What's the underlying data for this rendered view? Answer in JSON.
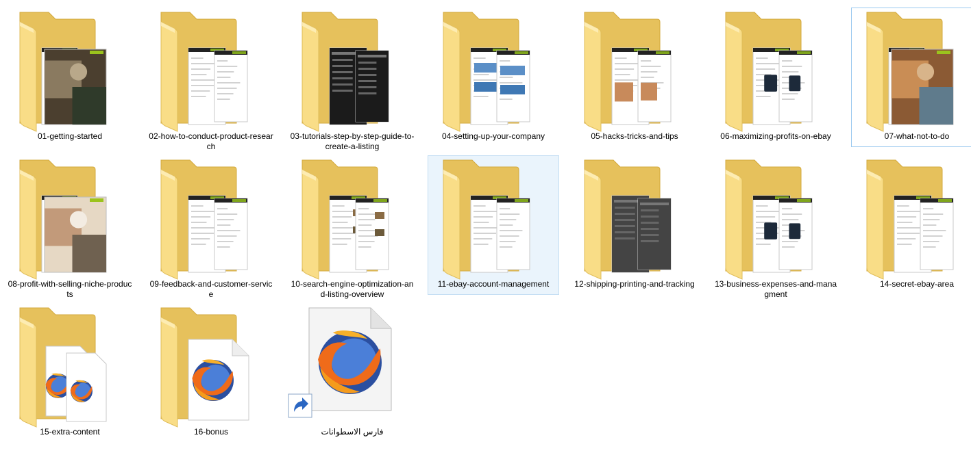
{
  "items": [
    {
      "label": "01-getting-started",
      "kind": "folder",
      "preview": "photo",
      "focus": false,
      "hover": false
    },
    {
      "label": "02-how-to-conduct-product-research",
      "kind": "folder",
      "preview": "screens",
      "focus": false,
      "hover": false
    },
    {
      "label": "03-tutorials-step-by-step-guide-to-create-a-listing",
      "kind": "folder",
      "preview": "dark",
      "focus": false,
      "hover": false
    },
    {
      "label": "04-setting-up-your-company",
      "kind": "folder",
      "preview": "screens-blue",
      "focus": false,
      "hover": false
    },
    {
      "label": "05-hacks-tricks-and-tips",
      "kind": "folder",
      "preview": "screens-photo",
      "focus": false,
      "hover": false
    },
    {
      "label": "06-maximizing-profits-on-ebay",
      "kind": "folder",
      "preview": "screens-device",
      "focus": false,
      "hover": false
    },
    {
      "label": "07-what-not-to-do",
      "kind": "folder",
      "preview": "photo-warm",
      "focus": true,
      "hover": false
    },
    {
      "label": "08-profit-with-selling-niche-products",
      "kind": "folder",
      "preview": "photo-hand",
      "focus": false,
      "hover": false
    },
    {
      "label": "09-feedback-and-customer-service",
      "kind": "folder",
      "preview": "screens",
      "focus": false,
      "hover": false
    },
    {
      "label": "10-search-engine-optimization-and-listing-overview",
      "kind": "folder",
      "preview": "screens-thumbs",
      "focus": false,
      "hover": false
    },
    {
      "label": "11-ebay-account-management",
      "kind": "folder",
      "preview": "screens-plain",
      "focus": false,
      "hover": true
    },
    {
      "label": "12-shipping-printing-and-tracking",
      "kind": "folder",
      "preview": "dark-gray",
      "focus": false,
      "hover": false
    },
    {
      "label": "13-business-expenses-and-managment",
      "kind": "folder",
      "preview": "screens-device",
      "focus": false,
      "hover": false
    },
    {
      "label": "14-secret-ebay-area",
      "kind": "folder",
      "preview": "screens-plain",
      "focus": false,
      "hover": false
    },
    {
      "label": "15-extra-content",
      "kind": "folder",
      "preview": "firefox-docs",
      "focus": false,
      "hover": false
    },
    {
      "label": "16-bonus",
      "kind": "folder",
      "preview": "firefox-doc",
      "focus": false,
      "hover": false
    },
    {
      "label": "فارس الاسطوانات",
      "kind": "shortcut",
      "preview": "firefox",
      "focus": false,
      "hover": false
    }
  ],
  "icon_names": {
    "folder": "folder-icon",
    "shortcut": "firefox-shortcut-icon",
    "overlay": "shortcut-arrow-icon"
  },
  "colors": {
    "folder_back": "#e6c15c",
    "folder_front": "#f9dd87",
    "selection_border": "#99c8ef",
    "hover_bg": "#eaf4fc",
    "firefox_orange": "#ef6b1a",
    "firefox_blue": "#2b4fa0"
  }
}
